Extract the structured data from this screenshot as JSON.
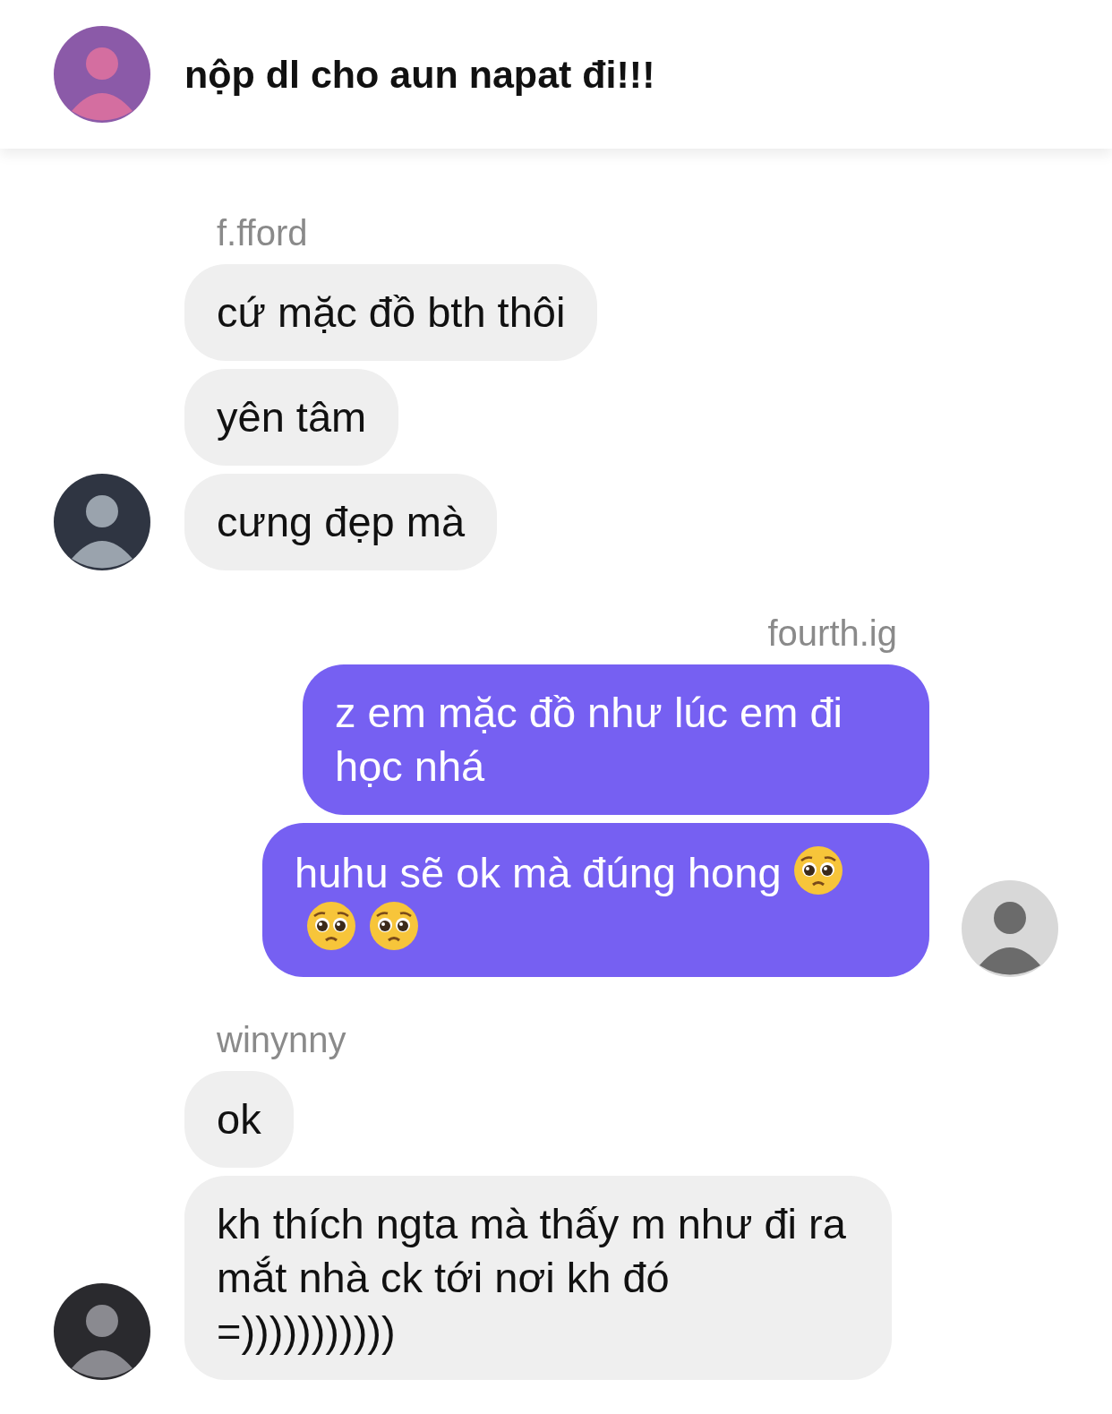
{
  "header": {
    "title": "nộp dl cho aun napat đi!!!"
  },
  "groups": [
    {
      "sender": "f.fford",
      "kind": "incoming",
      "messages": [
        {
          "text": "cứ mặc đồ bth thôi"
        },
        {
          "text": "yên tâm"
        },
        {
          "text": "cưng đẹp mà"
        }
      ]
    },
    {
      "sender": "fourth.ig",
      "kind": "outgoing",
      "messages": [
        {
          "text": "z em mặc đồ như lúc em đi học nhá"
        },
        {
          "text": "huhu sẽ ok mà đúng hong",
          "emoji": [
            {
              "kind": "pleading-face"
            },
            {
              "kind": "pleading-face"
            },
            {
              "kind": "pleading-face"
            }
          ]
        }
      ]
    },
    {
      "sender": "winynny",
      "kind": "incoming",
      "messages": [
        {
          "text": "ok"
        },
        {
          "text": "kh thích ngta mà thấy m như đi ra mắt nhà ck tới nơi kh đó =)))))))))))"
        }
      ]
    }
  ]
}
